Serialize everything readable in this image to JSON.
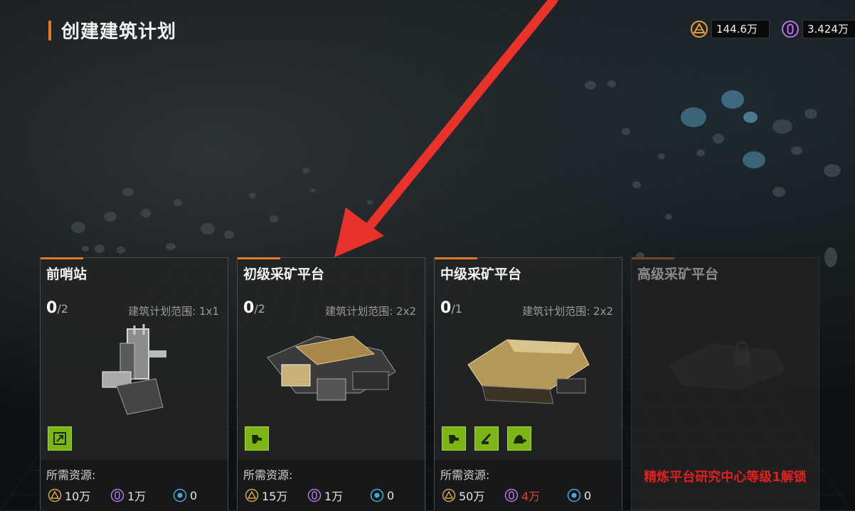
{
  "header": {
    "title": "创建建筑计划"
  },
  "currencies": [
    {
      "icon": "gold-ore-icon",
      "value": "144.6万"
    },
    {
      "icon": "crystal-icon",
      "value": "3.424万"
    }
  ],
  "cards": [
    {
      "name": "前哨站",
      "count": "0",
      "max": "/2",
      "range": "建筑计划范围: 1x1",
      "locked": false,
      "badges": [
        "build-module-icon"
      ],
      "resources_label": "所需资源:",
      "resources": [
        {
          "icon": "gold-ore-icon",
          "value": "10万",
          "warn": false
        },
        {
          "icon": "crystal-icon",
          "value": "1万",
          "warn": false
        },
        {
          "icon": "energy-icon",
          "value": "0",
          "warn": false
        }
      ]
    },
    {
      "name": "初级采矿平台",
      "count": "0",
      "max": "/2",
      "range": "建筑计划范围: 2x2",
      "locked": false,
      "badges": [
        "mining-module-icon"
      ],
      "resources_label": "所需资源:",
      "resources": [
        {
          "icon": "gold-ore-icon",
          "value": "15万",
          "warn": false
        },
        {
          "icon": "crystal-icon",
          "value": "1万",
          "warn": false
        },
        {
          "icon": "energy-icon",
          "value": "0",
          "warn": false
        }
      ]
    },
    {
      "name": "中级采矿平台",
      "count": "0",
      "max": "/1",
      "range": "建筑计划范围: 2x2",
      "locked": false,
      "badges": [
        "mining-module-icon",
        "drill-module-icon",
        "ore-plus-icon"
      ],
      "resources_label": "所需资源:",
      "resources": [
        {
          "icon": "gold-ore-icon",
          "value": "50万",
          "warn": false
        },
        {
          "icon": "crystal-icon",
          "value": "4万",
          "warn": true
        },
        {
          "icon": "energy-icon",
          "value": "0",
          "warn": false
        }
      ]
    },
    {
      "name": "高级采矿平台",
      "locked": true,
      "unlock_text": "精炼平台研究中心等级1解锁"
    }
  ],
  "colors": {
    "accent": "#e07a2a",
    "badge": "#7cb514",
    "warn": "#e8402a",
    "lock": "#e0201e"
  }
}
